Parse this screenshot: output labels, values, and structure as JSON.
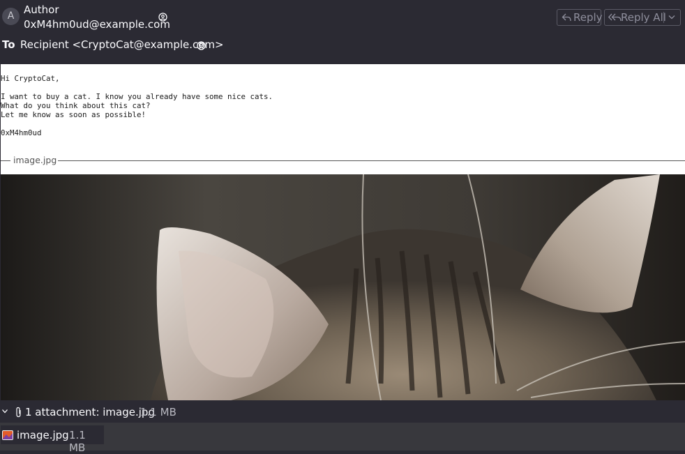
{
  "header": {
    "avatar_letter": "A",
    "author_label": "Author",
    "author_email": "0xM4hm0ud@example.com",
    "to_label": "To",
    "recipient": "Recipient <CryptoCat@example.com>",
    "buttons": {
      "reply": "Reply",
      "reply_all": "Reply All"
    }
  },
  "message": {
    "body": "Hi CryptoCat,\n\nI want to buy a cat. I know you already have some nice cats.\nWhat do you think about this cat?\nLet me know as soon as possible!\n\n0xM4hm0ud",
    "attachment_label": "image.jpg"
  },
  "attachments": {
    "summary": "1 attachment: image.jpg",
    "size": "1.1 MB",
    "items": [
      {
        "name": "image.jpg",
        "size": "1.1 MB"
      }
    ]
  }
}
